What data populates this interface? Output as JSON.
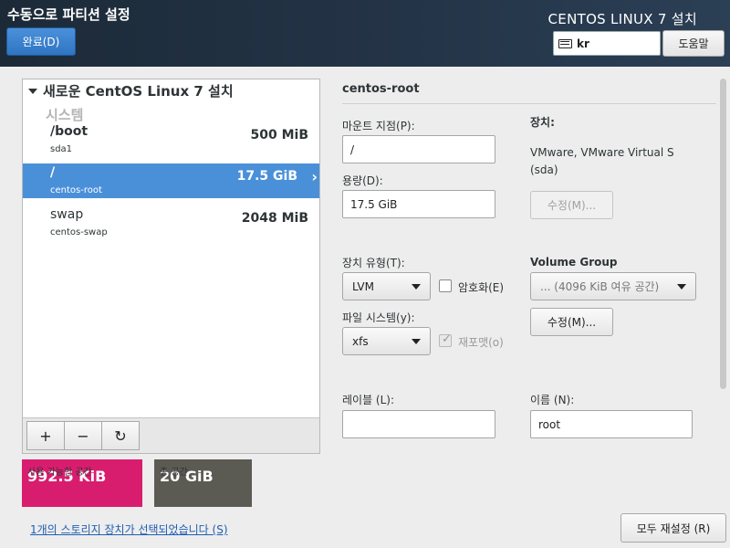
{
  "header": {
    "title": "수동으로 파티션 설정",
    "done_label": "완료(D)",
    "product": "CENTOS LINUX 7 설치",
    "keyboard": "kr",
    "help_label": "도움말"
  },
  "left": {
    "install_header": "새로운 CentOS Linux 7 설치",
    "section": "시스템",
    "mounts": [
      {
        "name": "/boot",
        "device": "sda1",
        "size": "500 MiB"
      },
      {
        "name": "/",
        "device": "centos-root",
        "size": "17.5 GiB",
        "selected": true
      },
      {
        "name": "swap",
        "device": "centos-swap",
        "size": "2048 MiB"
      }
    ],
    "toolbar": {
      "add": "+",
      "remove": "−",
      "refresh": "↻"
    }
  },
  "space": {
    "available_label": "사용 가능한 공간",
    "available_value": "992.5 KiB",
    "total_label": "총 공간",
    "total_value": "20 GiB"
  },
  "footer": {
    "storage_link": "1개의 스토리지 장치가 선택되었습니다 (S)",
    "reset_label": "모두 재설정 (R)"
  },
  "detail": {
    "title": "centos-root",
    "mount_label": "마운트 지점(P):",
    "mount_value": "/",
    "capacity_label": "용량(D):",
    "capacity_value": "17.5 GiB",
    "device_label": "장치:",
    "device_value": "VMware, VMware Virtual S",
    "device_value2": "(sda)",
    "modify_label": "수정(M)...",
    "device_type_label": "장치 유형(T):",
    "device_type_value": "LVM",
    "encrypt_label": "암호화(E)",
    "vg_label": "Volume Group",
    "vg_value": "...   (4096 KiB 여유 공간)",
    "vg_modify_label": "수정(M)...",
    "fs_label": "파일 시스템(y):",
    "fs_value": "xfs",
    "reformat_label": "재포맷(o)",
    "label_label": "레이블 (L):",
    "label_value": "",
    "name_label": "이름 (N):",
    "name_value": "root"
  }
}
